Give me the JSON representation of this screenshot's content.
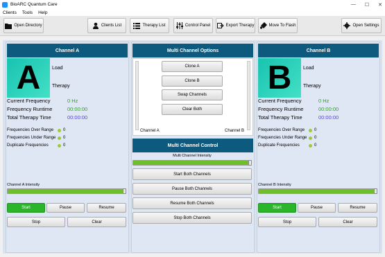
{
  "window": {
    "title": "BioARC Quantum Care",
    "min": "—",
    "max": "☐",
    "close": "✕"
  },
  "menu": [
    "Clients",
    "Tools",
    "Help"
  ],
  "toolbar": {
    "open_directory": "Open Directory",
    "clients_list": "Clients List",
    "therapy_list": "Therapy List",
    "control_panel": "Control Panel",
    "export_therapy": "Export Therapy",
    "move_to_flash": "Move To Flash",
    "open_settings": "Open Settings"
  },
  "channel_a": {
    "header": "Channel A",
    "letter": "A",
    "load": "Load",
    "therapy": "Therapy",
    "current_frequency_label": "Current Frequency",
    "current_frequency": "0 Hz",
    "frequency_runtime_label": "Frequency Runtime",
    "frequency_runtime": "00:00:00",
    "total_therapy_time_label": "Total Therapy Time",
    "total_therapy_time": "00:00:00",
    "over_range_label": "Frequencies Over Range",
    "over_range": "0",
    "under_range_label": "Frequencies Under Range",
    "under_range": "0",
    "duplicate_label": "Duplicate Frequencies",
    "duplicate": "0",
    "intensity_label": "Channel A Intensity",
    "intensity": 1.0,
    "start": "Start",
    "pause": "Pause",
    "resume": "Resume",
    "stop": "Stop",
    "clear": "Clear"
  },
  "multi_options": {
    "header": "Multi Channel Options",
    "clone_a": "Clone A",
    "clone_b": "Clone B",
    "swap": "Swap Channels",
    "clear_both": "Clear Both",
    "channel_a_label": "Channel A",
    "channel_b_label": "Channel B"
  },
  "multi_control": {
    "header": "Multi Channel Control",
    "intensity_label": "Multi Channel Intensity",
    "intensity": 1.0,
    "start_both": "Start Both Channels",
    "pause_both": "Pause Both Channels",
    "resume_both": "Resume Both Channels",
    "stop_both": "Stop Both Channels"
  },
  "channel_b": {
    "header": "Channel B",
    "letter": "B",
    "load": "Load",
    "therapy": "Therapy",
    "current_frequency_label": "Current Frequency",
    "current_frequency": "0 Hz",
    "frequency_runtime_label": "Frequency Runtime",
    "frequency_runtime": "00:00:00",
    "total_therapy_time_label": "Total Therapy Time",
    "total_therapy_time": "00:00:00",
    "over_range_label": "Frequencies Over Range",
    "over_range": "0",
    "under_range_label": "Frequencies Under Range",
    "under_range": "0",
    "duplicate_label": "Duplicate Frequencies",
    "duplicate": "0",
    "intensity_label": "Channel B Intensity",
    "intensity": 1.0,
    "start": "Start",
    "pause": "Pause",
    "resume": "Resume",
    "stop": "Stop",
    "clear": "Clear"
  },
  "colors": {
    "header": "#0e5a7e",
    "start": "#2ab52a",
    "green_text": "#33a02c",
    "purple_text": "#5b4ad8",
    "intensity": "#6fbf2a",
    "letter_tile": "#18c3b0"
  }
}
